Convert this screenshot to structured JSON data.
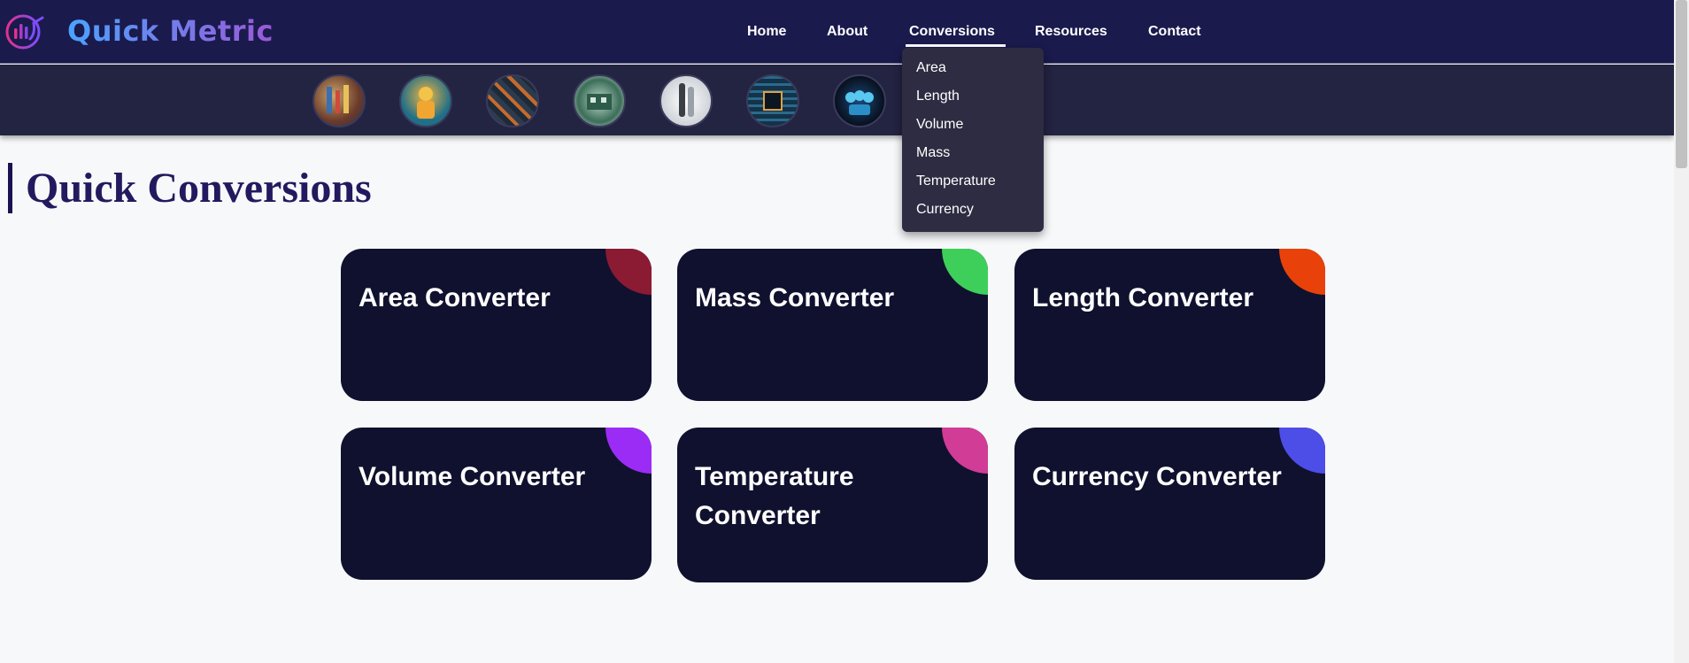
{
  "brand": {
    "name": "Quick Metric"
  },
  "nav": {
    "items": [
      "Home",
      "About",
      "Conversions",
      "Resources",
      "Contact"
    ],
    "active": "Conversions"
  },
  "dropdown": {
    "items": [
      "Area",
      "Length",
      "Volume",
      "Mass",
      "Temperature",
      "Currency"
    ]
  },
  "image_strip": {
    "thumbnails": [
      "tools-image",
      "worker-image",
      "circuit-board-image",
      "electronics-image",
      "measuring-devices-image",
      "chip-image",
      "robots-image"
    ]
  },
  "main": {
    "title": "Quick Conversions",
    "cards": [
      {
        "label": "Area Converter",
        "accent": "#8b1a33"
      },
      {
        "label": "Mass Converter",
        "accent": "#3ecf5a"
      },
      {
        "label": "Length Converter",
        "accent": "#e8420a"
      },
      {
        "label": "Volume Converter",
        "accent": "#9b2cf5"
      },
      {
        "label": "Temperature Converter",
        "accent": "#d13c96"
      },
      {
        "label": "Currency Converter",
        "accent": "#4d4de8"
      }
    ]
  }
}
